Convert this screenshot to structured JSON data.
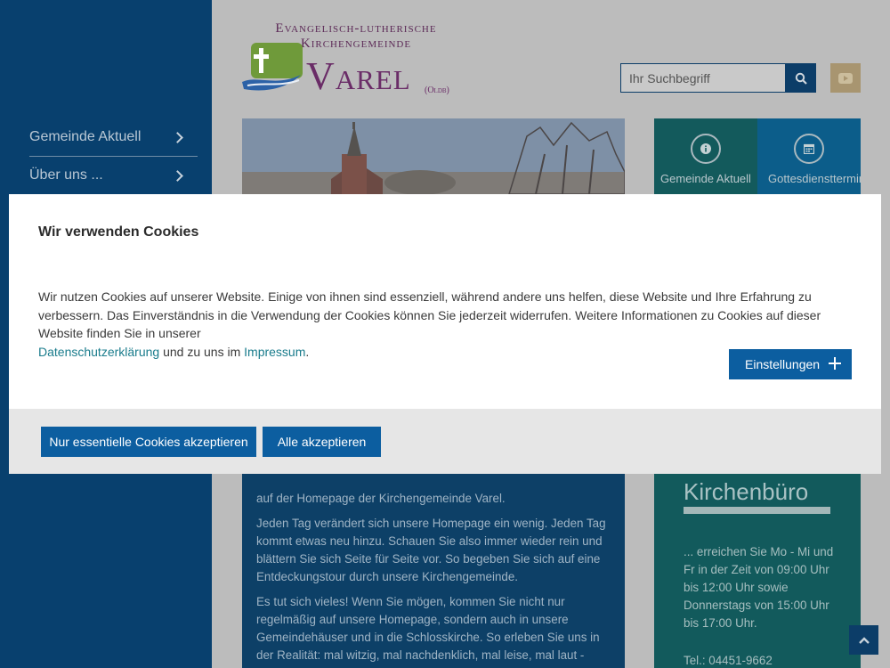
{
  "sidebar": {
    "items": [
      {
        "label": "Gemeinde Aktuell"
      },
      {
        "label": "Über uns ..."
      }
    ]
  },
  "logo": {
    "line1": "Evangelisch-lutherische",
    "line2": "Kirchengemeinde",
    "name": "Varel",
    "suffix": "(Oldb)"
  },
  "search": {
    "placeholder": "Ihr Suchbegriff",
    "icon": "search-icon"
  },
  "youtube": {
    "icon": "youtube-icon"
  },
  "tiles": [
    {
      "label": "Gemeinde Aktuell",
      "icon": "info-icon"
    },
    {
      "label": "Gottesdiensttermine",
      "icon": "calendar-icon"
    }
  ],
  "content": {
    "paragraphs": [
      "auf der Homepage der Kirchengemeinde Varel.",
      "Jeden Tag verändert sich unsere Homepage ein wenig. Jeden Tag kommt etwas neu hinzu. Schauen Sie also immer wieder rein und blättern Sie sich Seite für Seite vor. So begeben Sie sich auf eine Entdeckungstour durch unsere Kirchengemeinde.",
      "Es tut sich vieles! Wenn Sie mögen, kommen Sie nicht nur regelmäßig auf unsere Homepage, sondern auch in unsere Gemeindehäuser und in die Schlosskirche. So erleben Sie uns in der Realität: mal witzig, mal nachdenklich, mal leise, mal laut - aber"
    ]
  },
  "office": {
    "title": "Kirchenbüro",
    "hours": "... erreichen Sie Mo - Mi und Fr in der Zeit von 09:00 Uhr bis 12:00 Uhr sowie Donnerstags von 15:00 Uhr bis 17:00 Uhr.",
    "tel": "Tel.: 04451-9662"
  },
  "cookie": {
    "title": "Wir verwenden Cookies",
    "text": "Wir nutzen Cookies auf unserer Website. Einige von ihnen sind essenziell, während andere uns helfen, diese Website und Ihre Erfahrung zu verbessern. Das Einverständnis in die Verwendung der Cookies können Sie jederzeit widerrufen. Weitere Informationen zu Cookies auf dieser Website finden Sie in unserer",
    "privacy_link": "Datenschutzerklärung",
    "middle": "und zu uns im",
    "imprint_link": "Impressum",
    "end": ".",
    "settings_label": "Einstellungen",
    "essential_label": "Nur essentielle Cookies akzeptieren",
    "accept_all_label": "Alle akzeptieren"
  },
  "colors": {
    "sidebar": "#08406e",
    "primary_button": "#0c5ea0",
    "link": "#1a7c8c",
    "logo_purple": "#6a2c67"
  }
}
